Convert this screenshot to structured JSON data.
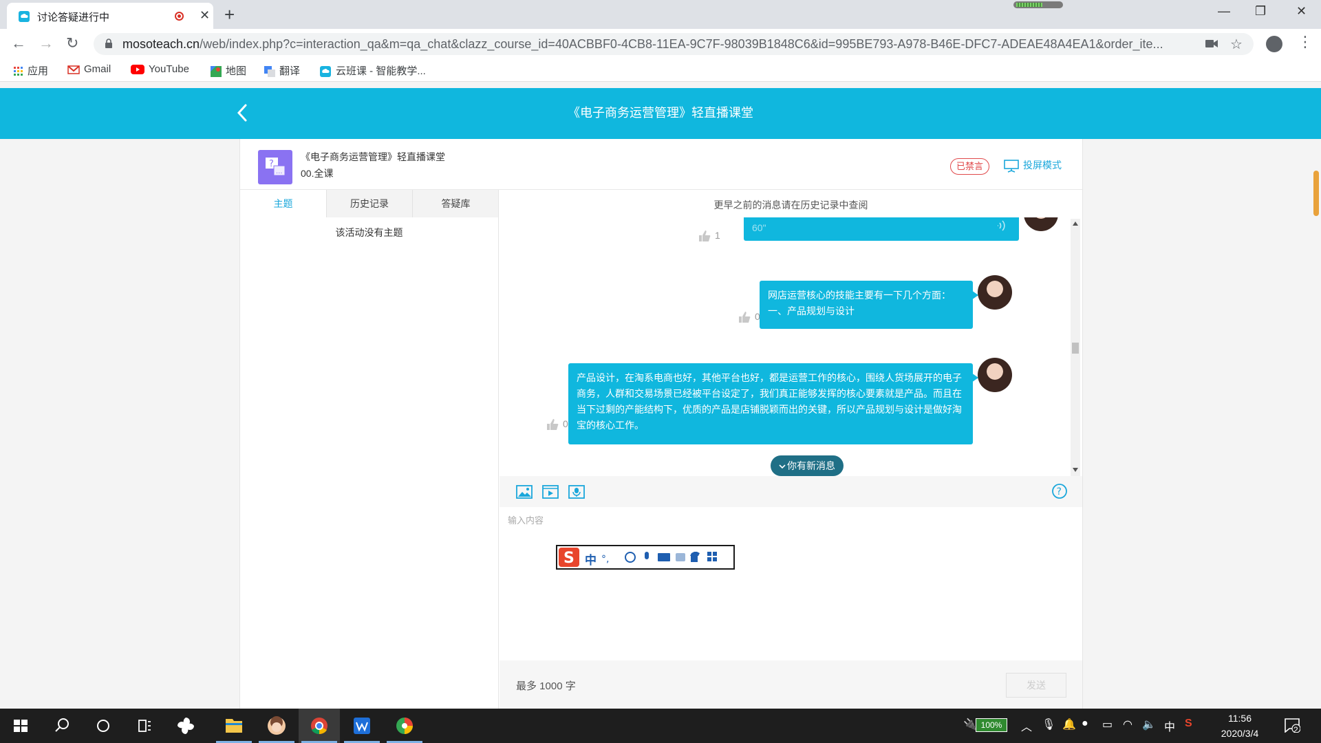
{
  "browser": {
    "tab_title": "讨论答疑进行中",
    "url_host": "mosoteach.cn",
    "url_rest": "/web/index.php?c=interaction_qa&m=qa_chat&clazz_course_id=40ACBBF0-4CB8-11EA-9C7F-98039B1848C6&id=995BE793-A978-B46E-DFC7-ADEAE48A4EA1&order_ite...",
    "bookmarks": [
      "应用",
      "Gmail",
      "YouTube",
      "地图",
      "翻译",
      "云班课 - 智能教学..."
    ]
  },
  "app": {
    "header_title": "《电子商务运营管理》轻直播课堂",
    "course_title": "《电子商务运营管理》轻直播课堂",
    "course_sub": "00.全课",
    "muted_label": "已禁言",
    "projection_label": "投屏模式",
    "tabs": [
      "主题",
      "历史记录",
      "答疑库"
    ],
    "active_tab": "主题",
    "empty_topic": "该活动没有主题",
    "history_hint": "更早之前的消息请在历史记录中查阅",
    "messages": [
      {
        "kind": "voice",
        "duration": "60\"",
        "likes": "1"
      },
      {
        "kind": "text",
        "text": "网店运营核心的技能主要有一下几个方面：一、产品规划与设计",
        "likes": "0"
      },
      {
        "kind": "text",
        "text": "产品设计，在淘系电商也好，其他平台也好，都是运营工作的核心，围绕人货场展开的电子商务，人群和交易场景已经被平台设定了，我们真正能够发挥的核心要素就是产品。而且在当下过剩的产能结构下，优质的产品是店铺脱颖而出的关键，所以产品规划与设计是做好淘宝的核心工作。",
        "likes": "0"
      }
    ],
    "new_message_label": "你有新消息",
    "input_placeholder": "输入内容",
    "limit_label": "最多 1000 字",
    "send_label": "发送"
  },
  "ime": {
    "lang": "中"
  },
  "taskbar": {
    "battery": "100%",
    "ime_lang": "中",
    "time": "11:56",
    "date": "2020/3/4",
    "notifications": "2"
  },
  "colors": {
    "accent": "#10b7de",
    "muted": "#e0484a",
    "avatar_bg": "#8a72f2"
  }
}
